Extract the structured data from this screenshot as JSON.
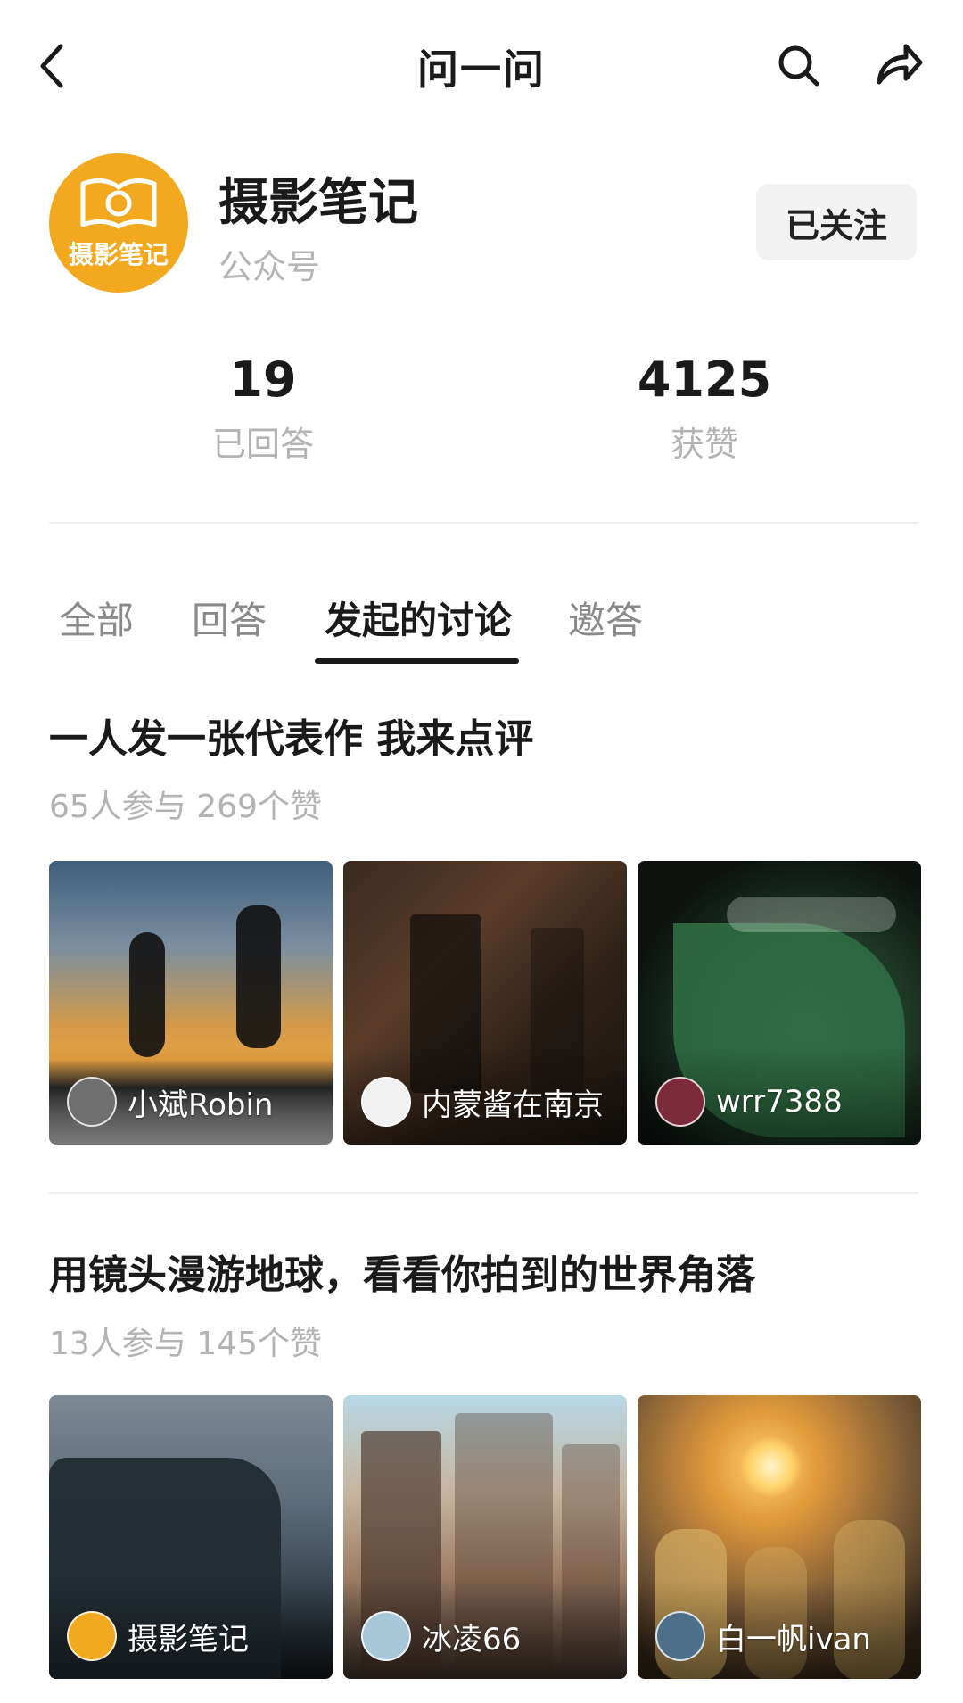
{
  "header": {
    "title": "问一问",
    "back_icon": "chevron-left-icon",
    "search_icon": "search-icon",
    "share_icon": "share-icon"
  },
  "profile": {
    "name": "摄影笔记",
    "type": "公众号",
    "follow_label": "已关注",
    "avatar_text": "摄影笔记",
    "avatar_color": "#f2a81f"
  },
  "stats": [
    {
      "value": "19",
      "label": "已回答"
    },
    {
      "value": "4125",
      "label": "获赞"
    }
  ],
  "tabs": [
    {
      "label": "全部",
      "active": false
    },
    {
      "label": "回答",
      "active": false
    },
    {
      "label": "发起的讨论",
      "active": true
    },
    {
      "label": "邀答",
      "active": false
    }
  ],
  "topics": [
    {
      "title": "一人发一张代表作 我来点评",
      "meta": "65人参与  269个赞",
      "photos": [
        {
          "user": "小斌Robin"
        },
        {
          "user": "内蒙酱在南京"
        },
        {
          "user": "wrr7388"
        }
      ]
    },
    {
      "title": "用镜头漫游地球，看看你拍到的世界角落",
      "meta": "13人参与  145个赞",
      "photos": [
        {
          "user": "摄影笔记"
        },
        {
          "user": "冰凌66"
        },
        {
          "user": "白一帆ivan"
        }
      ]
    }
  ]
}
